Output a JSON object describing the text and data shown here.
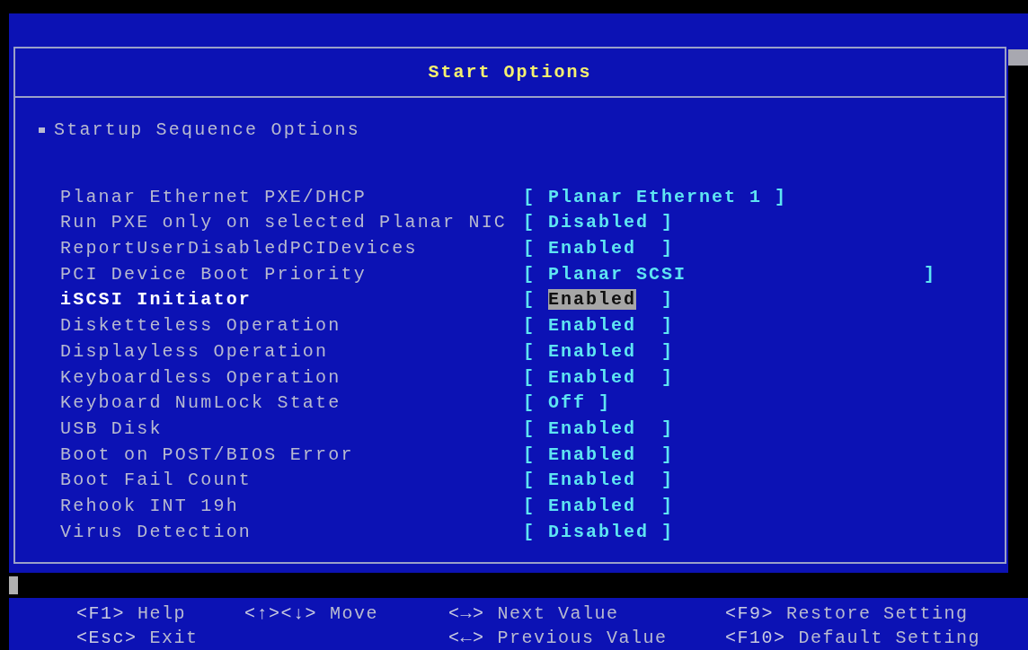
{
  "panel": {
    "title": "Start Options",
    "section": "Startup Sequence Options"
  },
  "settings": [
    {
      "label": "Planar Ethernet PXE/DHCP",
      "open": "[",
      "value": "Planar Ethernet 1",
      "close": "]",
      "kind": "plain",
      "selected": false
    },
    {
      "label": "Run PXE only on selected Planar NIC",
      "open": "[",
      "value": "Disabled",
      "close": "]",
      "kind": "option",
      "selected": false
    },
    {
      "label": "ReportUserDisabledPCIDevices",
      "open": "[",
      "value": "Enabled",
      "close": "]",
      "kind": "option",
      "selected": false
    },
    {
      "label": "PCI Device Boot Priority",
      "open": "[",
      "value": "Planar SCSI",
      "close": "]",
      "kind": "list",
      "selected": false
    },
    {
      "label": "iSCSI Initiator",
      "open": "[",
      "value": "Enabled",
      "close": "]",
      "kind": "option",
      "selected": true
    },
    {
      "label": "Disketteless Operation",
      "open": "[",
      "value": "Enabled",
      "close": "]",
      "kind": "option",
      "selected": false
    },
    {
      "label": "Displayless Operation",
      "open": "[",
      "value": "Enabled",
      "close": "]",
      "kind": "option",
      "selected": false
    },
    {
      "label": "Keyboardless Operation",
      "open": "[",
      "value": "Enabled",
      "close": "]",
      "kind": "option",
      "selected": false
    },
    {
      "label": "Keyboard NumLock State",
      "open": "[",
      "value": "Off",
      "close": "]",
      "kind": "plain",
      "selected": false
    },
    {
      "label": "USB Disk",
      "open": "[",
      "value": "Enabled",
      "close": "]",
      "kind": "option",
      "selected": false
    },
    {
      "label": "Boot on POST/BIOS Error",
      "open": "[",
      "value": "Enabled",
      "close": "]",
      "kind": "option",
      "selected": false
    },
    {
      "label": "Boot Fail Count",
      "open": "[",
      "value": "Enabled",
      "close": "]",
      "kind": "option",
      "selected": false
    },
    {
      "label": "Rehook INT 19h",
      "open": "[",
      "value": "Enabled",
      "close": "]",
      "kind": "option",
      "selected": false
    },
    {
      "label": "Virus Detection",
      "open": "[",
      "value": "Disabled",
      "close": "]",
      "kind": "option",
      "selected": false
    }
  ],
  "footer": [
    [
      {
        "key": "<F1>",
        "action": "Help"
      },
      {
        "key": "<Esc>",
        "action": "Exit"
      }
    ],
    [
      {
        "key": "<↑><↓>",
        "action": "Move"
      }
    ],
    [
      {
        "key": "<→>",
        "action": "Next Value"
      },
      {
        "key": "<←>",
        "action": "Previous Value"
      }
    ],
    [
      {
        "key": "<F9>",
        "action": "Restore Setting"
      },
      {
        "key": "<F10>",
        "action": "Default Setting"
      }
    ]
  ]
}
